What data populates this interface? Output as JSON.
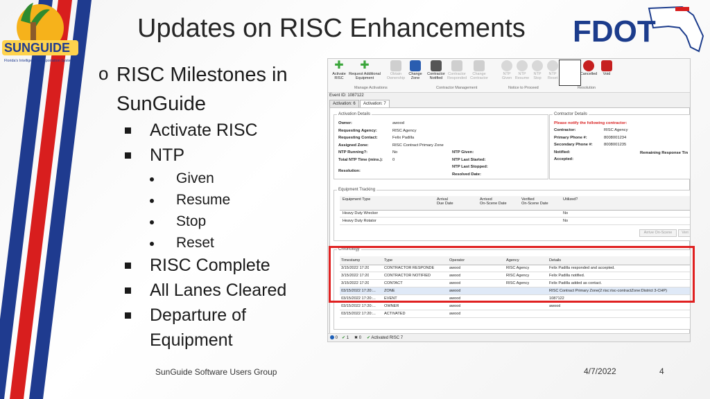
{
  "slide": {
    "title": "Updates on RISC Enhancements",
    "colors": {
      "stripe_red": "#d81e1e",
      "stripe_blue": "#1f3b8f",
      "fdot_blue": "#1c3c8c",
      "highlight_red": "#e02020"
    },
    "logos": {
      "left_text": "SUNGUIDE",
      "left_subtitle": "Florida's Intelligent Transportation System",
      "right_text": "FDOT"
    },
    "bullets": {
      "level1": {
        "marker": "o",
        "text_line1": "RISC Milestones in",
        "text_line2": "SunGuide"
      },
      "items": [
        {
          "label": "Activate RISC"
        },
        {
          "label": "NTP",
          "sub": [
            "Given",
            "Resume",
            "Stop",
            "Reset"
          ]
        },
        {
          "label": "RISC Complete"
        },
        {
          "label": "All Lanes Cleared"
        },
        {
          "label_line1": "Departure of",
          "label_line2": "Equipment"
        }
      ]
    },
    "footer": {
      "left": "SunGuide Software Users Group",
      "date": "4/7/2022",
      "page": "4"
    }
  },
  "screenshot": {
    "ribbon_buttons": [
      {
        "label": "Activate\nRISC",
        "icon": "plus-icon",
        "dim": false
      },
      {
        "label": "Request Additional\nEquipment",
        "icon": "plus-icon",
        "dim": false
      },
      {
        "label": "Obtain\nOwnership",
        "icon": "lock-icon",
        "dim": true
      },
      {
        "label": "Change\nZone",
        "icon": "pin-icon",
        "dim": false
      },
      {
        "label": "Contractor\nNotified",
        "icon": "printer-icon",
        "dim": false
      },
      {
        "label": "Contractor\nResponded",
        "icon": "cloud-icon",
        "dim": true
      },
      {
        "label": "Change\nContractor",
        "icon": "refresh-icon",
        "dim": true
      },
      {
        "label": "NTP\nGiven",
        "icon": "play-icon",
        "dim": true
      },
      {
        "label": "NTP\nResume",
        "icon": "play-icon",
        "dim": true
      },
      {
        "label": "NTP\nStop",
        "icon": "stop-icon",
        "dim": true
      },
      {
        "label": "NTP\nReset",
        "icon": "reset-icon",
        "dim": true
      },
      {
        "label": "RISC\nComplete",
        "icon": "check-icon",
        "dim": false
      },
      {
        "label": "Cancelled",
        "icon": "cancel-icon",
        "dim": false
      },
      {
        "label": "Void",
        "icon": "void-icon",
        "dim": false
      }
    ],
    "groups": [
      "Manage Activations",
      "Contractor Management",
      "Notice to Proceed",
      "Resolution"
    ],
    "event_id": "Event ID:  1087122",
    "tabs": [
      "Activation: 6",
      "Activation: 7"
    ],
    "activation_details": {
      "title": "Activation Details",
      "left": [
        {
          "k": "Owner:",
          "v": "awood"
        },
        {
          "k": "Requesting Agency:",
          "v": "RISC Agency"
        },
        {
          "k": "Requesting Contact:",
          "v": "Felix Padilla"
        },
        {
          "k": "Assigned Zone:",
          "v": "RISC Contract Primary Zone"
        },
        {
          "k": "NTP Running?:",
          "v": "No"
        },
        {
          "k": "Total NTP Time (mins.):",
          "v": "0"
        },
        {
          "k": "Resolution:",
          "v": ""
        }
      ],
      "mid": [
        {
          "k": "NTP Given:",
          "v": ""
        },
        {
          "k": "NTP Last Started:",
          "v": ""
        },
        {
          "k": "NTP Last Stopped:",
          "v": ""
        },
        {
          "k": "Resolved Date:",
          "v": ""
        }
      ]
    },
    "contractor_details": {
      "title": "Contractor Details",
      "notice": "Please notify the following contractor:",
      "rows": [
        {
          "k": "Contractor:",
          "v": "RISC Agency"
        },
        {
          "k": "Primary Phone #:",
          "v": "8008001234"
        },
        {
          "k": "Secondary Phone #:",
          "v": "8008001235"
        },
        {
          "k": "Notified:",
          "v": ""
        },
        {
          "k": "Accepted:",
          "v": ""
        }
      ],
      "remaining": "Remaining Response Tin"
    },
    "equipment": {
      "title": "Equipment Tracking",
      "headers": [
        "Equipment Type",
        "Arrival\nDue Date",
        "Arrived\nOn-Scene Date",
        "Verified\nOn-Scene Date",
        "Utilized?"
      ],
      "rows": [
        [
          "Heavy Duty Wrecker",
          "",
          "",
          "",
          "No"
        ],
        [
          "Heavy Duty Rotator",
          "",
          "",
          "",
          "No"
        ]
      ],
      "buttons": [
        "Arrive On-Scene",
        "Veri"
      ]
    },
    "chronology": {
      "title": "Chronology",
      "headers": [
        "Timestamp",
        "Type",
        "Operator",
        "Agency",
        "Details"
      ],
      "rows": [
        [
          "3/15/2022 17:20",
          "CONTRACTOR RESPONDE",
          "awood",
          "RISC Agency",
          "Felix Padilla responded and accepted."
        ],
        [
          "3/15/2022 17:20",
          "CONTRACTOR NOTIFIED",
          "awood",
          "RISC Agency",
          "Felix Padilla notified."
        ],
        [
          "3/15/2022 17:20",
          "CONTACT",
          "awood",
          "RISC Agency",
          "Felix Padilla added as contact."
        ],
        [
          "03/15/2022 17:20:...",
          "ZONE",
          "awood",
          "",
          "RISC Contract Primary Zone(2:risc:risc-contractZone:District 3-CHP)"
        ],
        [
          "03/15/2022 17:20:...",
          "EVENT",
          "awood",
          "",
          "1087122"
        ],
        [
          "03/15/2022 17:20:...",
          "OWNER",
          "awood",
          "",
          "awood"
        ],
        [
          "03/15/2022 17:20:...",
          "ACTIVATED",
          "awood",
          "",
          ""
        ]
      ]
    },
    "statusbar": {
      "errors": "0",
      "checks": "1",
      "x": "0",
      "activated": "Activated RISC 7"
    }
  }
}
